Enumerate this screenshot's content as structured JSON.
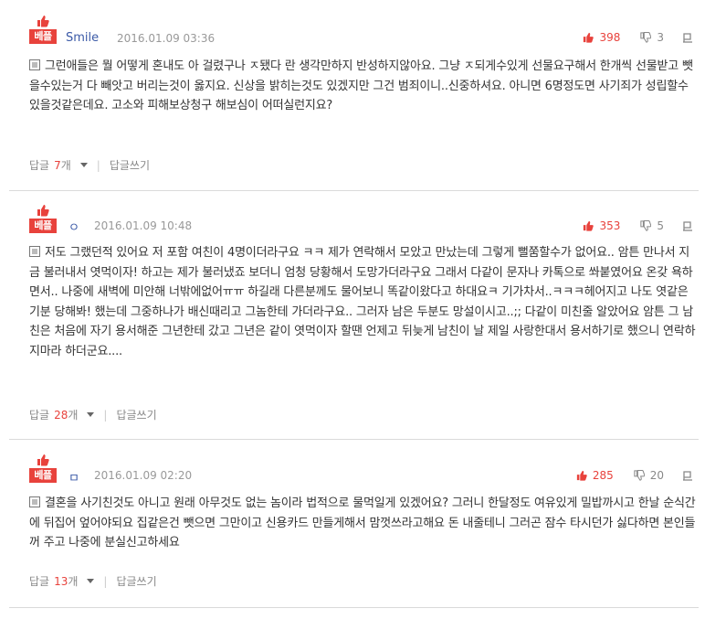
{
  "best_label": "베플",
  "reply_label": "답글",
  "reply_unit": "개",
  "reply_write": "답글쓰기",
  "divider": "|",
  "comments": [
    {
      "user": "Smile",
      "date": "2016.01.09 03:36",
      "likes": "398",
      "dislikes": "3",
      "text": "그런애들은 뭘 어떻게 혼내도 아 걸렸구나 ㅈ됐다 란 생각만하지 반성하지않아요. 그냥 ㅈ되게수있게 선물요구해서 한개씩 선물받고 뺏을수있는거 다 빼앗고 버리는것이 옳지요. 신상을 밝히는것도 있겠지만 그건 범죄이니..신중하셔요. 아니면 6명정도면 사기죄가 성립할수있을것같은데요. 고소와 피해보상청구 해보심이 어떠실런지요?",
      "reply_count": "7"
    },
    {
      "user": "ㅇ",
      "date": "2016.01.09 10:48",
      "likes": "353",
      "dislikes": "5",
      "text": "저도 그랬던적 있어요 저 포함 여친이 4명이더라구요 ㅋㅋ 제가 연락해서 모았고 만났는데 그렇게 뻘쭘할수가 없어요.. 암튼 만나서 지금 불러내서 엿먹이자! 하고는 제가 불러냈죠 보더니 엄청 당황해서 도망가더라구요 그래서 다같이 문자나 카톡으로 쏴붙였어요 온갖 욕하면서.. 나중에 새벽에 미안해 너밖에없어ㅠㅠ 하길래 다른분께도 물어보니 똑같이왔다고 하대요ㅋ 기가차서..ㅋㅋㅋ헤어지고 나도 엿같은기분 당해봐! 했는데 그중하나가 배신때리고 그놈한테 가더라구요.. 그러자 남은 두분도 망설이시고..;; 다같이 미친줄 알았어요 암튼 그 남친은 처음에 자기 용서해준 그년한테 갔고 그년은 같이 엿먹이자 할땐 언제고 뒤늦게 남친이 날 제일 사랑한대서 용서하기로 했으니 연락하지마라 하더군요....",
      "reply_count": "28"
    },
    {
      "user": "ㅁ",
      "date": "2016.01.09 02:20",
      "likes": "285",
      "dislikes": "20",
      "text": "결혼을 사기친것도 아니고 원래 아무것도 없는 놈이라 법적으로 물먹일게 있겠어요? 그러니 한달정도 여유있게 밀밥까시고 한날 순식간에 뒤집어 엎어야되요 집같은건 뺏으면 그만이고 신용카드 만들게해서 맘껏쓰라고해요 돈 내줄테니 그러곤 잠수 타시던가 싫다하면 본인들꺼 주고 나중에 분실신고하세요",
      "reply_count": "13"
    }
  ]
}
